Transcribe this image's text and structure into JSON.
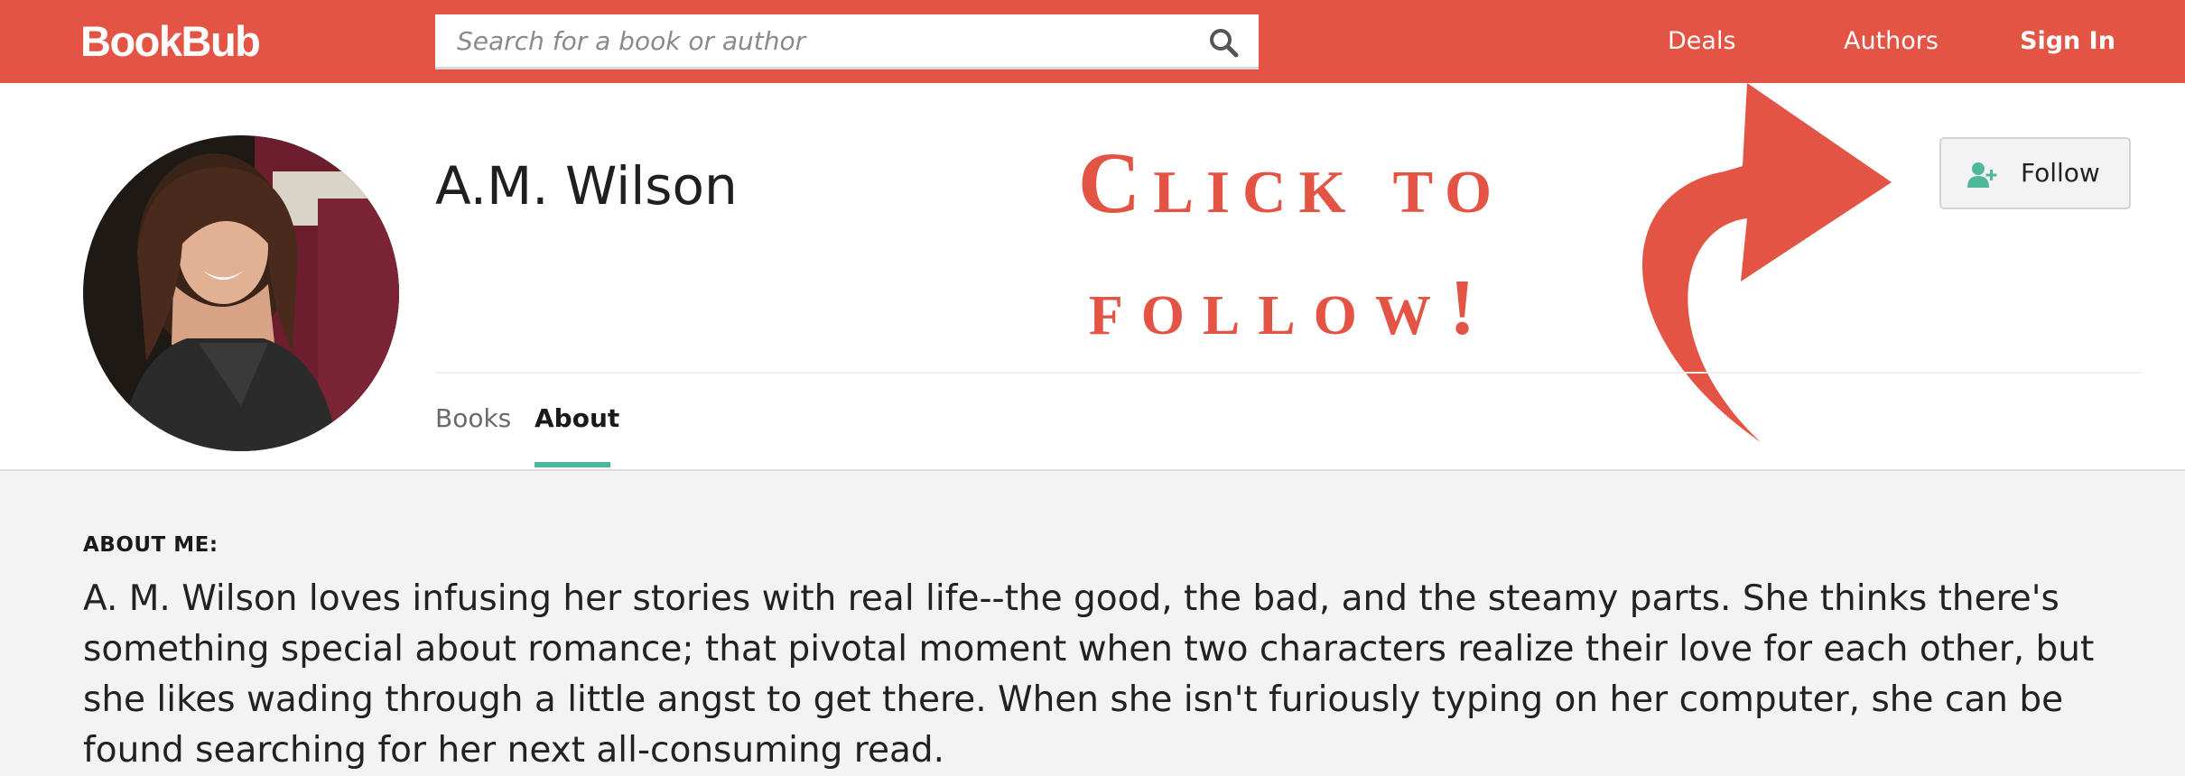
{
  "header": {
    "logo": "BookBub",
    "search": {
      "placeholder": "Search for a book or author",
      "value": ""
    },
    "nav": {
      "deals": "Deals",
      "authors": "Authors",
      "sign_in": "Sign In"
    },
    "brand_color": "#e35444"
  },
  "author": {
    "name": "A.M. Wilson"
  },
  "callout": {
    "line1": "Click to",
    "line2": "follow!"
  },
  "follow_button": {
    "label": "Follow",
    "icon": "add-user-icon",
    "accent_color": "#4fb79a"
  },
  "tabs": [
    {
      "label": "Books",
      "active": false
    },
    {
      "label": "About",
      "active": true
    }
  ],
  "about": {
    "heading": "ABOUT ME:",
    "text": "A. M. Wilson loves infusing her stories with real life--the good, the bad, and the steamy parts. She thinks there's something special about romance; that pivotal moment when two characters realize their love for each other, but she likes wading through a little angst to get there. When she isn't furiously typing on her computer, she can be found searching for her next all-consuming read."
  }
}
